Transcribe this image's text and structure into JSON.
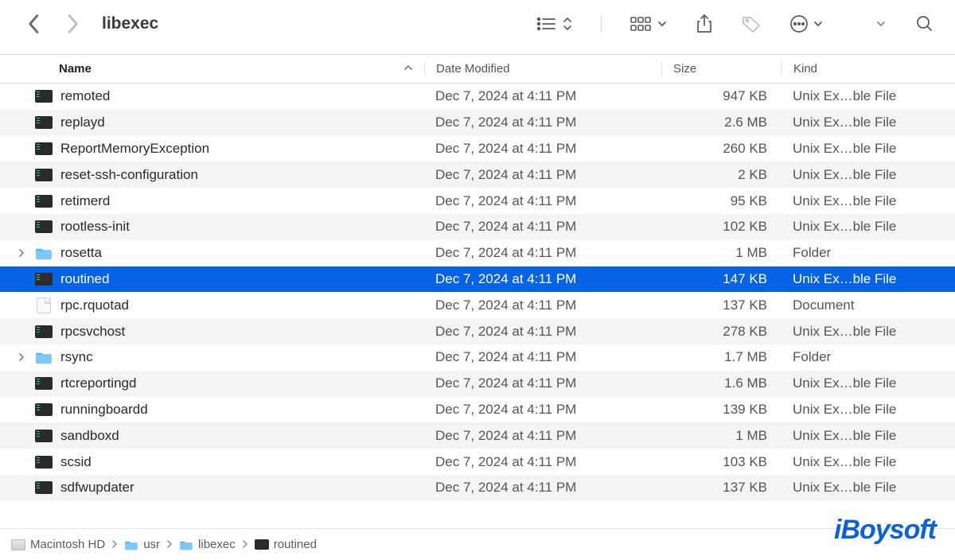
{
  "window": {
    "title": "libexec"
  },
  "columns": {
    "name": "Name",
    "date": "Date Modified",
    "size": "Size",
    "kind": "Kind"
  },
  "kinds": {
    "exec": "Unix Ex…ble File",
    "folder": "Folder",
    "doc": "Document"
  },
  "watermark": "iBoysoft",
  "path": [
    {
      "label": "Macintosh HD",
      "icon": "hd"
    },
    {
      "label": "usr",
      "icon": "folder"
    },
    {
      "label": "libexec",
      "icon": "folder"
    },
    {
      "label": "routined",
      "icon": "exec"
    }
  ],
  "rows": [
    {
      "name": "remoted",
      "date": "Dec 7, 2024 at 4:11 PM",
      "size": "947 KB",
      "kind": "exec",
      "icon": "exec",
      "disclosure": false,
      "selected": false
    },
    {
      "name": "replayd",
      "date": "Dec 7, 2024 at 4:11 PM",
      "size": "2.6 MB",
      "kind": "exec",
      "icon": "exec",
      "disclosure": false,
      "selected": false
    },
    {
      "name": "ReportMemoryException",
      "date": "Dec 7, 2024 at 4:11 PM",
      "size": "260 KB",
      "kind": "exec",
      "icon": "exec",
      "disclosure": false,
      "selected": false
    },
    {
      "name": "reset-ssh-configuration",
      "date": "Dec 7, 2024 at 4:11 PM",
      "size": "2 KB",
      "kind": "exec",
      "icon": "exec",
      "disclosure": false,
      "selected": false
    },
    {
      "name": "retimerd",
      "date": "Dec 7, 2024 at 4:11 PM",
      "size": "95 KB",
      "kind": "exec",
      "icon": "exec",
      "disclosure": false,
      "selected": false
    },
    {
      "name": "rootless-init",
      "date": "Dec 7, 2024 at 4:11 PM",
      "size": "102 KB",
      "kind": "exec",
      "icon": "exec",
      "disclosure": false,
      "selected": false
    },
    {
      "name": "rosetta",
      "date": "Dec 7, 2024 at 4:11 PM",
      "size": "1 MB",
      "kind": "folder",
      "icon": "folder",
      "disclosure": true,
      "selected": false
    },
    {
      "name": "routined",
      "date": "Dec 7, 2024 at 4:11 PM",
      "size": "147 KB",
      "kind": "exec",
      "icon": "exec",
      "disclosure": false,
      "selected": true
    },
    {
      "name": "rpc.rquotad",
      "date": "Dec 7, 2024 at 4:11 PM",
      "size": "137 KB",
      "kind": "doc",
      "icon": "doc",
      "disclosure": false,
      "selected": false
    },
    {
      "name": "rpcsvchost",
      "date": "Dec 7, 2024 at 4:11 PM",
      "size": "278 KB",
      "kind": "exec",
      "icon": "exec",
      "disclosure": false,
      "selected": false
    },
    {
      "name": "rsync",
      "date": "Dec 7, 2024 at 4:11 PM",
      "size": "1.7 MB",
      "kind": "folder",
      "icon": "folder",
      "disclosure": true,
      "selected": false
    },
    {
      "name": "rtcreportingd",
      "date": "Dec 7, 2024 at 4:11 PM",
      "size": "1.6 MB",
      "kind": "exec",
      "icon": "exec",
      "disclosure": false,
      "selected": false
    },
    {
      "name": "runningboardd",
      "date": "Dec 7, 2024 at 4:11 PM",
      "size": "139 KB",
      "kind": "exec",
      "icon": "exec",
      "disclosure": false,
      "selected": false
    },
    {
      "name": "sandboxd",
      "date": "Dec 7, 2024 at 4:11 PM",
      "size": "1 MB",
      "kind": "exec",
      "icon": "exec",
      "disclosure": false,
      "selected": false
    },
    {
      "name": "scsid",
      "date": "Dec 7, 2024 at 4:11 PM",
      "size": "103 KB",
      "kind": "exec",
      "icon": "exec",
      "disclosure": false,
      "selected": false
    },
    {
      "name": "sdfwupdater",
      "date": "Dec 7, 2024 at 4:11 PM",
      "size": "137 KB",
      "kind": "exec",
      "icon": "exec",
      "disclosure": false,
      "selected": false
    }
  ]
}
